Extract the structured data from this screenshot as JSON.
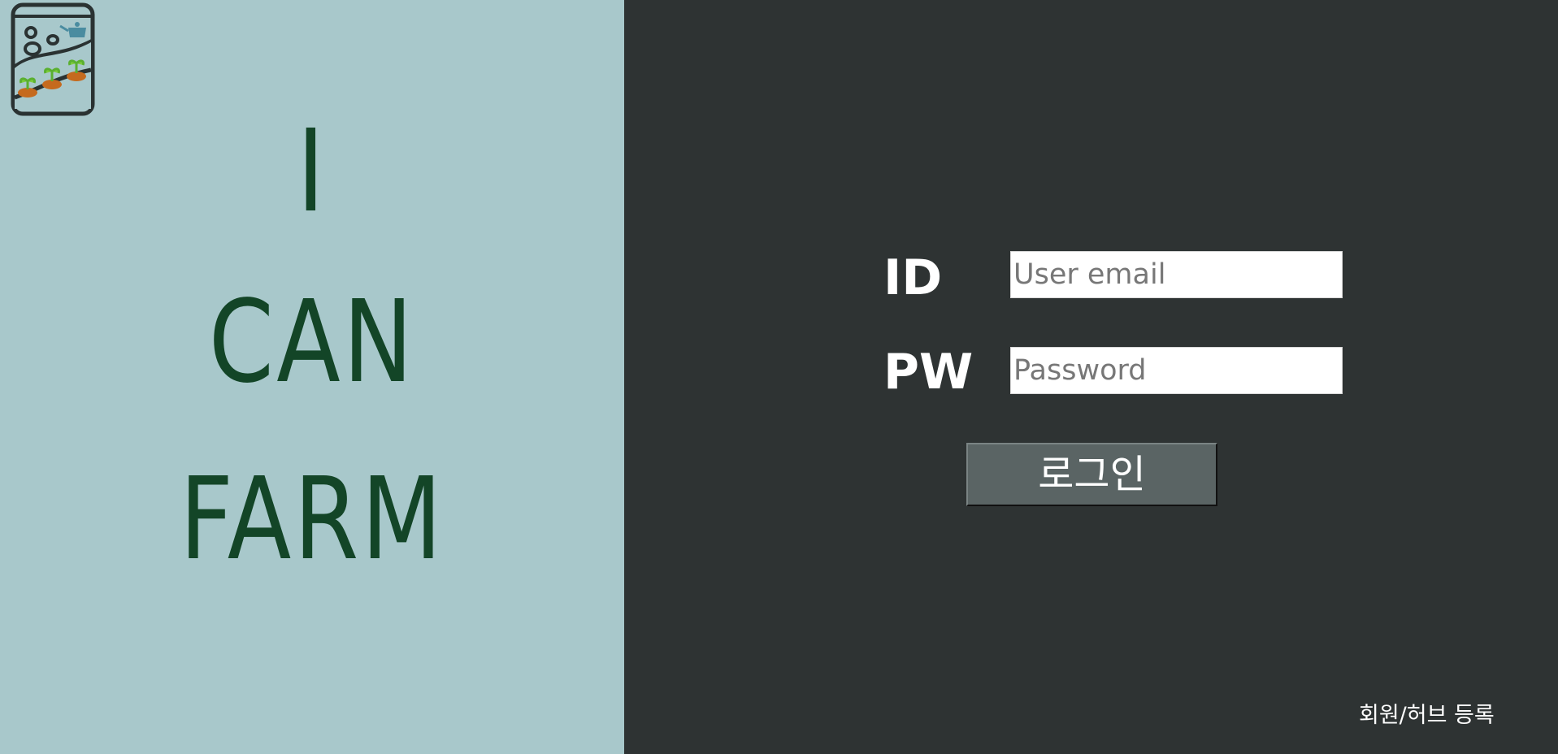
{
  "brand": {
    "logo_icon": "seed-jar-logo-icon",
    "words": [
      "I",
      "CAN",
      "FARM"
    ],
    "color": "#134527"
  },
  "colors": {
    "left_background": "#a8c8cb",
    "right_background": "#2e3333",
    "button_background": "#5a6464"
  },
  "login_form": {
    "id_label": "ID",
    "email_placeholder": "User email",
    "email_value": "",
    "pw_label": "PW",
    "password_placeholder": "Password",
    "password_value": "",
    "submit_label": "로그인"
  },
  "footer": {
    "register_link": "회원/허브 등록"
  }
}
